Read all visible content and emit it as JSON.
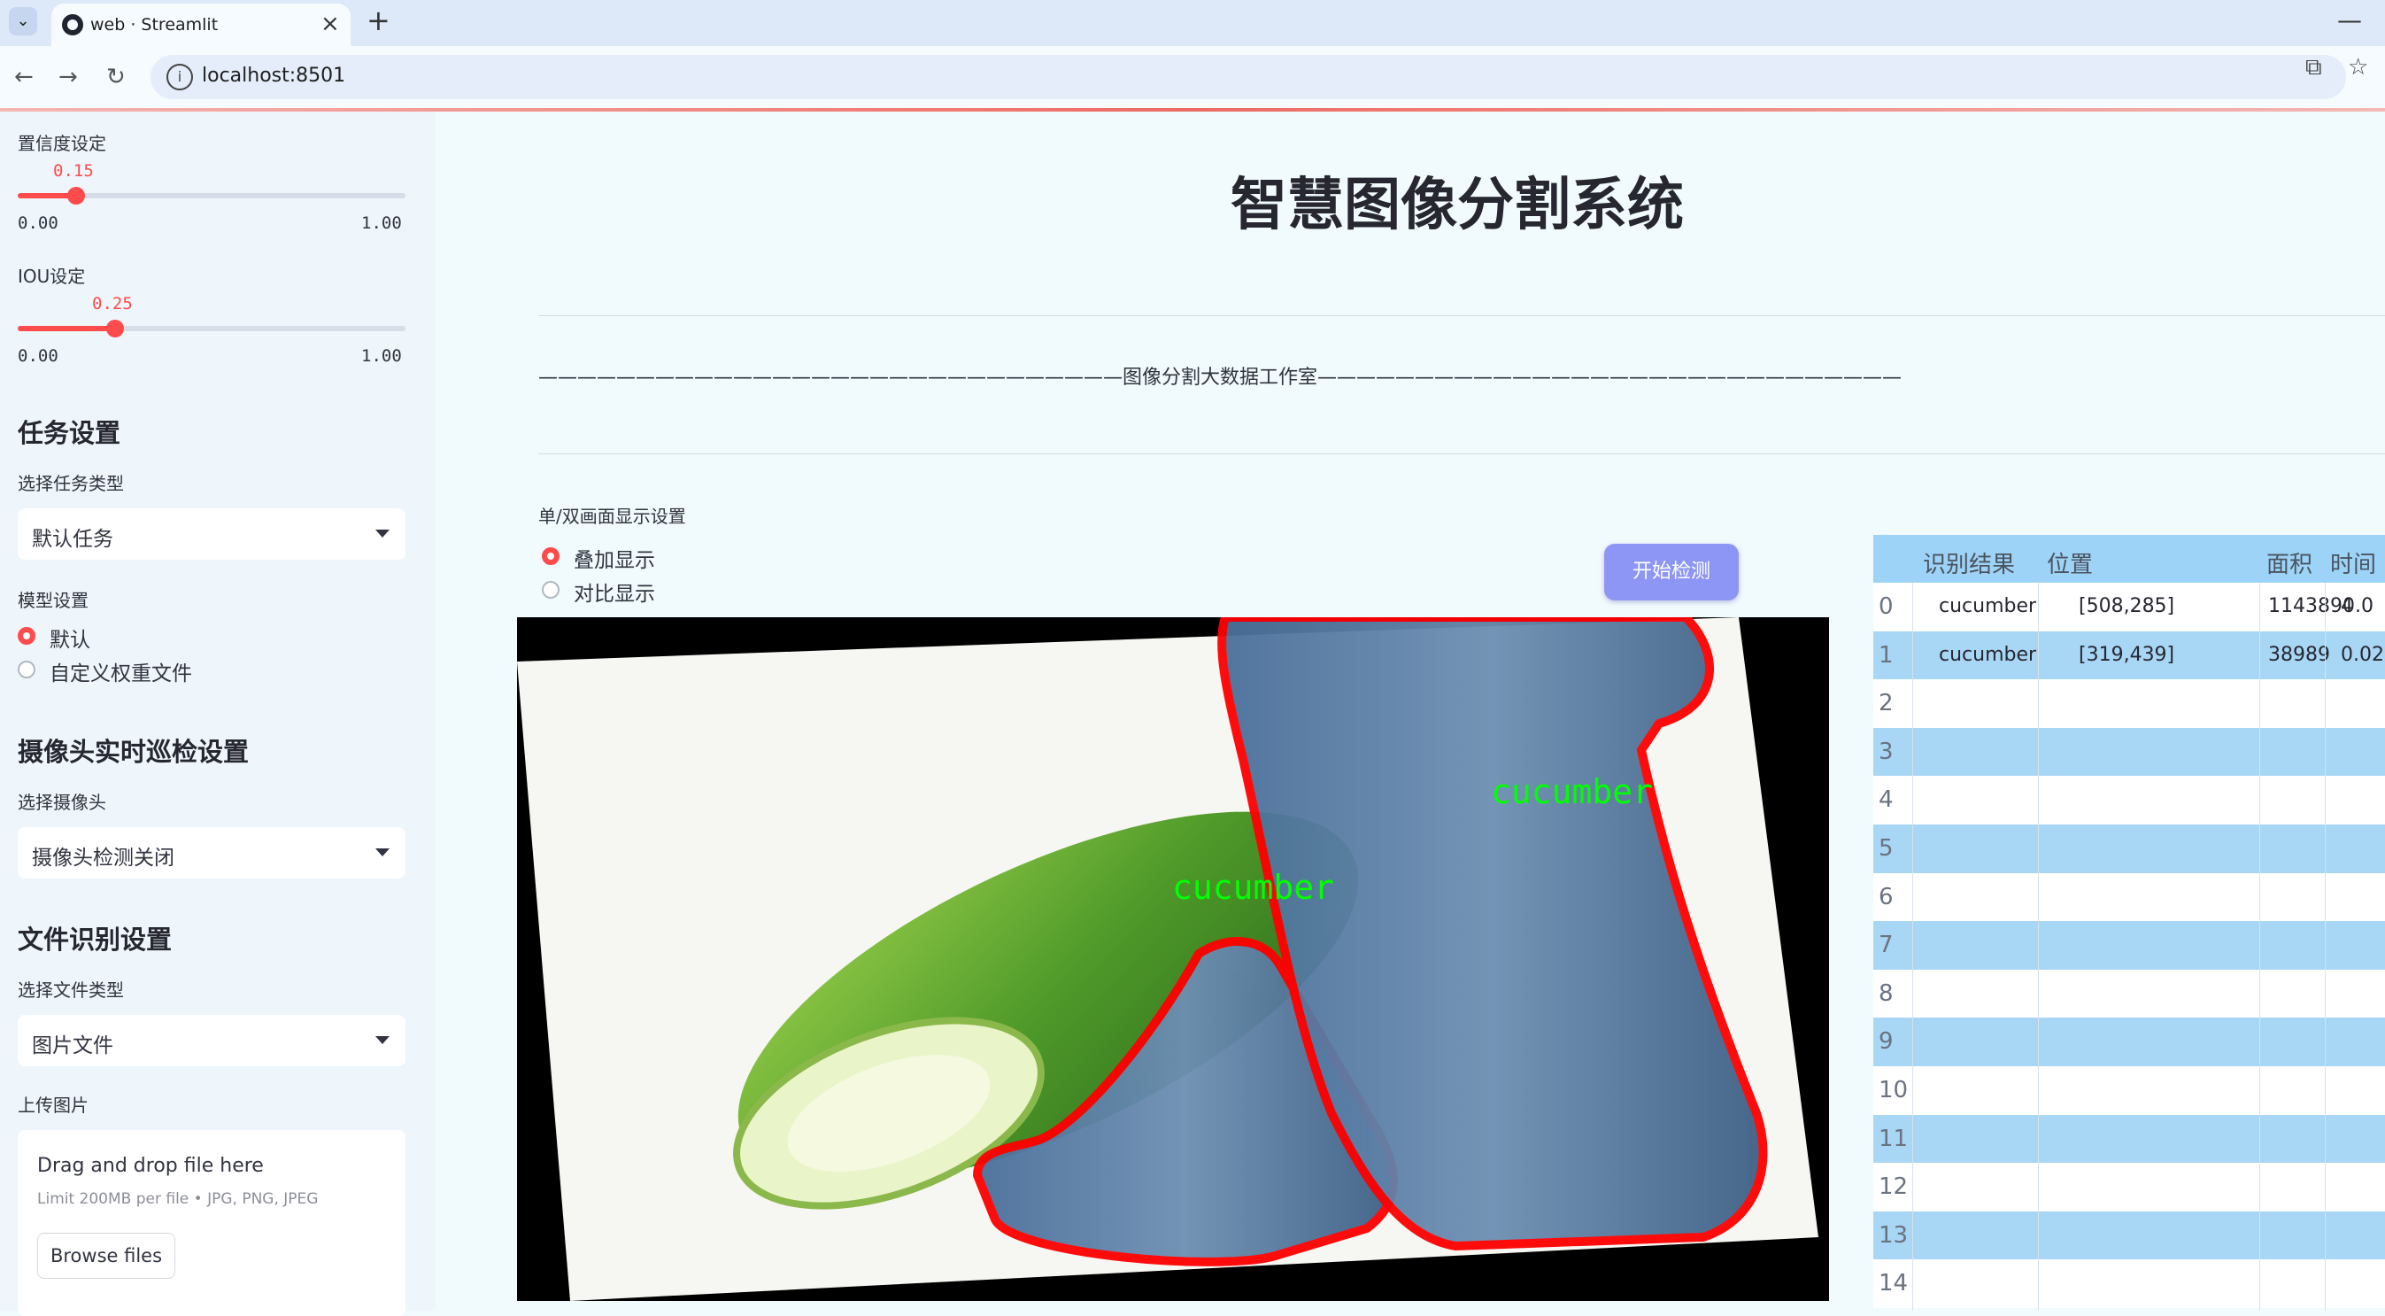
{
  "browser": {
    "tab_title": "web · Streamlit",
    "url": "localhost:8501",
    "new_tab_label": "+",
    "close_label": "×"
  },
  "sidebar": {
    "confidence": {
      "label": "置信度设定",
      "value": "0.15",
      "value_fraction": 0.15,
      "min": "0.00",
      "max": "1.00"
    },
    "iou": {
      "label": "IOU设定",
      "value": "0.25",
      "value_fraction": 0.25,
      "min": "0.00",
      "max": "1.00"
    },
    "task_section": {
      "title": "任务设置",
      "select_label": "选择任务类型",
      "selected": "默认任务"
    },
    "model_section": {
      "label": "模型设置",
      "options": [
        "默认",
        "自定义权重文件"
      ],
      "selected_index": 0
    },
    "camera_section": {
      "title": "摄像头实时巡检设置",
      "select_label": "选择摄像头",
      "selected": "摄像头检测关闭"
    },
    "file_section": {
      "title": "文件识别设置",
      "select_label": "选择文件类型",
      "selected": "图片文件"
    },
    "upload": {
      "label": "上传图片",
      "drop_text": "Drag and drop file here",
      "limit_text": "Limit 200MB per file • JPG, PNG, JPEG",
      "button": "Browse files"
    }
  },
  "main": {
    "title": "智慧图像分割系统",
    "divider_text": "——————————————————————————————图像分割大数据工作室——————————————————————————————",
    "display_mode": {
      "label": "单/双画面显示设置",
      "options": [
        "叠加显示",
        "对比显示"
      ],
      "selected_index": 0
    },
    "detect_button": "开始检测",
    "image_labels": [
      "cucumber",
      "cucumber"
    ]
  },
  "results_table": {
    "columns": [
      "识别结果",
      "位置",
      "面积",
      "时间"
    ],
    "rows": [
      {
        "index": "0",
        "result": "cucumber",
        "position": "[508,285]",
        "area": "1143890.0",
        "time": "4"
      },
      {
        "index": "1",
        "result": "cucumber",
        "position": "[319,439]",
        "area": "38989",
        "time": "0.02"
      },
      {
        "index": "2",
        "result": "",
        "position": "",
        "area": "",
        "time": ""
      },
      {
        "index": "3",
        "result": "",
        "position": "",
        "area": "",
        "time": ""
      },
      {
        "index": "4",
        "result": "",
        "position": "",
        "area": "",
        "time": ""
      },
      {
        "index": "5",
        "result": "",
        "position": "",
        "area": "",
        "time": ""
      },
      {
        "index": "6",
        "result": "",
        "position": "",
        "area": "",
        "time": ""
      },
      {
        "index": "7",
        "result": "",
        "position": "",
        "area": "",
        "time": ""
      },
      {
        "index": "8",
        "result": "",
        "position": "",
        "area": "",
        "time": ""
      },
      {
        "index": "9",
        "result": "",
        "position": "",
        "area": "",
        "time": ""
      },
      {
        "index": "10",
        "result": "",
        "position": "",
        "area": "",
        "time": ""
      },
      {
        "index": "11",
        "result": "",
        "position": "",
        "area": "",
        "time": ""
      },
      {
        "index": "12",
        "result": "",
        "position": "",
        "area": "",
        "time": ""
      },
      {
        "index": "13",
        "result": "",
        "position": "",
        "area": "",
        "time": ""
      },
      {
        "index": "14",
        "result": "",
        "position": "",
        "area": "",
        "time": ""
      }
    ]
  },
  "colors": {
    "accent": "#ff4b4b",
    "button": "#8e96f5",
    "table_header": "#9dd3f6",
    "row_alt": "#a8d6f5",
    "mask_outline": "#ff0000",
    "label_green": "#00ff00"
  }
}
